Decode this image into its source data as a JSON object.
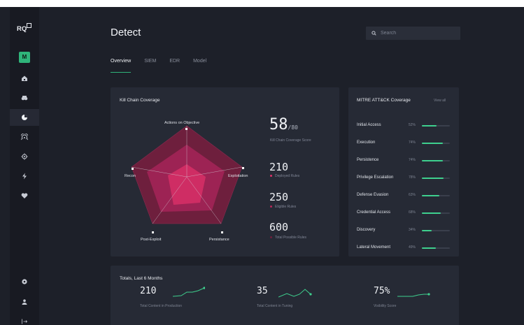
{
  "app": {
    "logo_text": "RQ",
    "avatar_initial": "M"
  },
  "sidebar": {
    "items": [
      {
        "icon": "home-icon"
      },
      {
        "icon": "binoculars-icon"
      },
      {
        "icon": "radar-icon",
        "active": true
      },
      {
        "icon": "signal-icon"
      },
      {
        "icon": "target-icon"
      },
      {
        "icon": "bolt-icon"
      },
      {
        "icon": "heart-icon"
      }
    ],
    "bottom": [
      {
        "icon": "settings-icon"
      },
      {
        "icon": "user-icon"
      },
      {
        "icon": "logout-icon"
      }
    ]
  },
  "header": {
    "title": "Detect",
    "search_placeholder": "Search",
    "tabs": [
      "Overview",
      "SIEM",
      "EDR",
      "Model"
    ],
    "active_tab": "Overview"
  },
  "kill_chain": {
    "title": "Kill Chain Coverage",
    "labels": {
      "top": "Actions on Objective",
      "right": "Exploitation",
      "bottom_right": "Persistance",
      "bottom_left": "Post-Exploit",
      "left": "Recon"
    },
    "score": "58",
    "score_suffix": "/80",
    "score_label": "Kill Chain Coverage Score",
    "deployed_value": "210",
    "deployed_label": "Deployed Rules",
    "eligible_value": "250",
    "eligible_label": "Eligible Rules",
    "total_value": "600",
    "total_label": "Total Possible Rules",
    "colors": {
      "deployed": "#e0316a",
      "eligible": "#b8285a",
      "total": "#6e1f3d"
    }
  },
  "mitre": {
    "title": "MITRE ATT&CK Coverage",
    "view_all": "View all",
    "rows": [
      {
        "name": "Initial Access",
        "pct": "52%",
        "value": 0.52
      },
      {
        "name": "Execution",
        "pct": "74%",
        "value": 0.74
      },
      {
        "name": "Persistence",
        "pct": "74%",
        "value": 0.74
      },
      {
        "name": "Privilege Escalation",
        "pct": "78%",
        "value": 0.78
      },
      {
        "name": "Defense Evasion",
        "pct": "63%",
        "value": 0.63
      },
      {
        "name": "Credential Access",
        "pct": "68%",
        "value": 0.68
      },
      {
        "name": "Discovery",
        "pct": "34%",
        "value": 0.34
      },
      {
        "name": "Lateral Movement",
        "pct": "49%",
        "value": 0.49
      }
    ]
  },
  "totals": {
    "title": "Totals, Last 6 Months",
    "items": [
      {
        "value": "210",
        "label": "Total Content in Production"
      },
      {
        "value": "35",
        "label": "Total Content in Tuning"
      },
      {
        "value": "75%",
        "label": "Visibility Score"
      }
    ]
  }
}
